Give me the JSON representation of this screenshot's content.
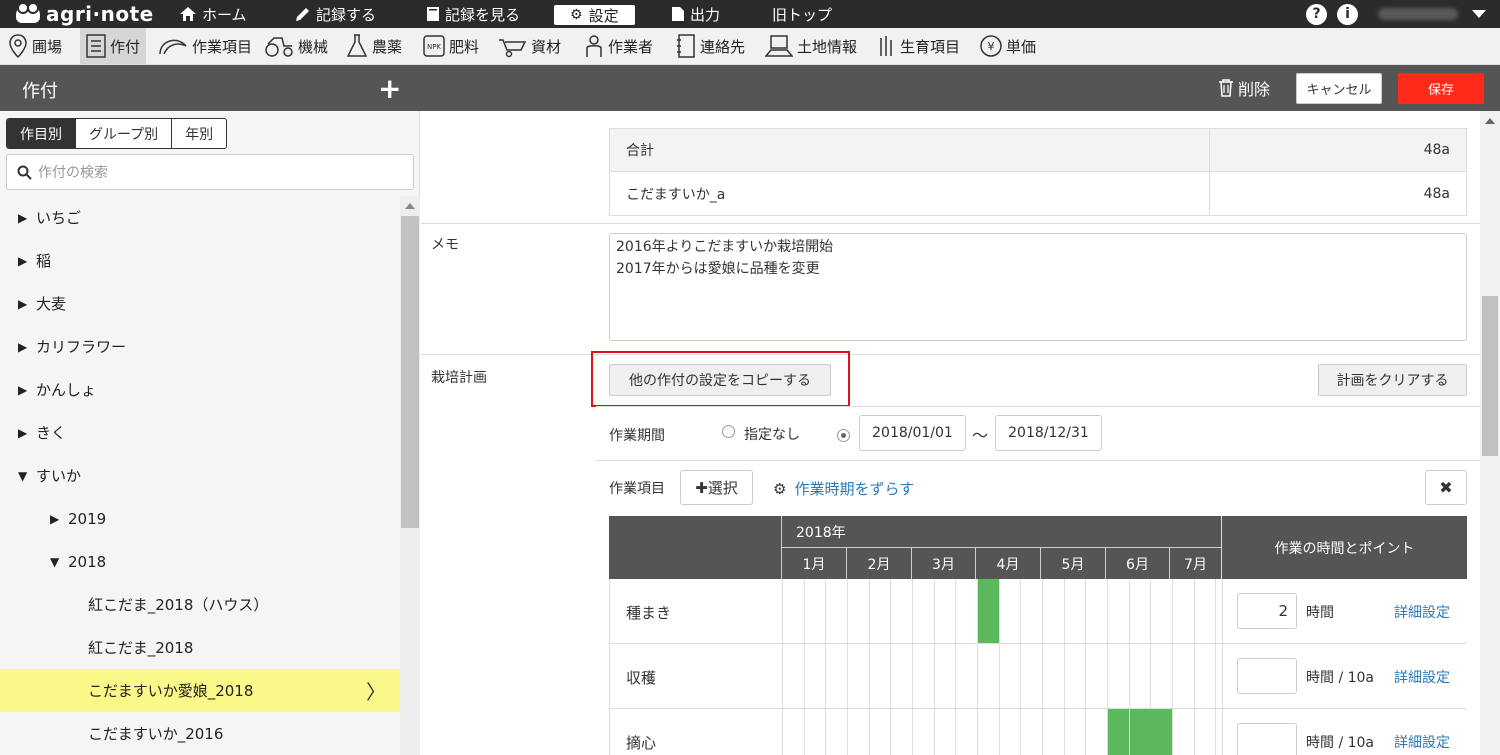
{
  "app": {
    "logo": "agri·note"
  },
  "topnav": [
    {
      "label": "ホーム",
      "icon": "home-icon"
    },
    {
      "label": "記録する",
      "icon": "pencil-icon"
    },
    {
      "label": "記録を見る",
      "icon": "notebook-icon"
    },
    {
      "label": "設定",
      "icon": "gear-icon"
    },
    {
      "label": "出力",
      "icon": "document-icon"
    },
    {
      "label": "旧トップ",
      "icon": ""
    }
  ],
  "topright": {
    "help": "?",
    "info": "i"
  },
  "subnav": [
    {
      "label": "圃場",
      "icon": "map-pin-icon"
    },
    {
      "label": "作付",
      "icon": "list-icon"
    },
    {
      "label": "作業項目",
      "icon": "sickle-icon"
    },
    {
      "label": "機械",
      "icon": "tractor-icon"
    },
    {
      "label": "農薬",
      "icon": "flask-icon"
    },
    {
      "label": "肥料",
      "icon": "fertilizer-icon"
    },
    {
      "label": "資材",
      "icon": "wheelbarrow-icon"
    },
    {
      "label": "作業者",
      "icon": "worker-icon"
    },
    {
      "label": "連絡先",
      "icon": "phone-book-icon"
    },
    {
      "label": "土地情報",
      "icon": "land-icon"
    },
    {
      "label": "生育項目",
      "icon": "growth-icon"
    },
    {
      "label": "単価",
      "icon": "yen-icon"
    }
  ],
  "header": {
    "title": "作付",
    "delete": "削除",
    "cancel": "キャンセル",
    "save": "保存"
  },
  "sidebar": {
    "tabs": [
      "作目別",
      "グループ別",
      "年別"
    ],
    "search_placeholder": "作付の検索",
    "tree": [
      {
        "label": "いちご",
        "tri": "▶"
      },
      {
        "label": "稲",
        "tri": "▶"
      },
      {
        "label": "大麦",
        "tri": "▶"
      },
      {
        "label": "カリフラワー",
        "tri": "▶"
      },
      {
        "label": "かんしょ",
        "tri": "▶"
      },
      {
        "label": "きく",
        "tri": "▶"
      },
      {
        "label": "すいか",
        "tri": "▼"
      },
      {
        "label": "2019",
        "tri": "▶"
      },
      {
        "label": "2018",
        "tri": "▼"
      },
      {
        "label": "紅こだま_2018（ハウス）",
        "tri": ""
      },
      {
        "label": "紅こだま_2018",
        "tri": ""
      },
      {
        "label": "こだますいか愛娘_2018",
        "tri": "",
        "chev": "〉"
      },
      {
        "label": "こだますいか_2016",
        "tri": ""
      }
    ]
  },
  "area_table": {
    "rows": [
      {
        "name": "合計",
        "value": "48a"
      },
      {
        "name": "こだますいか_a",
        "value": "48a"
      }
    ]
  },
  "memo": {
    "label": "メモ",
    "text": "2016年よりこだますいか栽培開始\n2017年からは愛娘に品種を変更"
  },
  "plan": {
    "label": "栽培計画",
    "copy_button": "他の作付の設定をコピーする",
    "clear_button": "計画をクリアする",
    "period_label": "作業期間",
    "none_option": "指定なし",
    "start_date": "2018/01/01",
    "tilde": "～",
    "end_date": "2018/12/31",
    "items_label": "作業項目",
    "select_button": "✚選択",
    "shift_link": "作業時期をずらす",
    "close": "✖"
  },
  "gantt": {
    "year": "2018年",
    "months": [
      "1月",
      "2月",
      "3月",
      "4月",
      "5月",
      "6月",
      "7月"
    ],
    "points_header": "作業の時間とポイント",
    "bar_color": "#5cb85c",
    "rows": [
      {
        "name": "種まき",
        "hours": "2",
        "unit": "時間",
        "detail": "詳細設定",
        "weeks": [
          9
        ]
      },
      {
        "name": "収穫",
        "hours": "",
        "unit": "時間 / 10a",
        "detail": "詳細設定",
        "weeks": []
      },
      {
        "name": "摘心",
        "hours": "",
        "unit": "時間 / 10a",
        "detail": "詳細設定",
        "weeks": [
          15,
          16,
          17
        ]
      }
    ]
  }
}
